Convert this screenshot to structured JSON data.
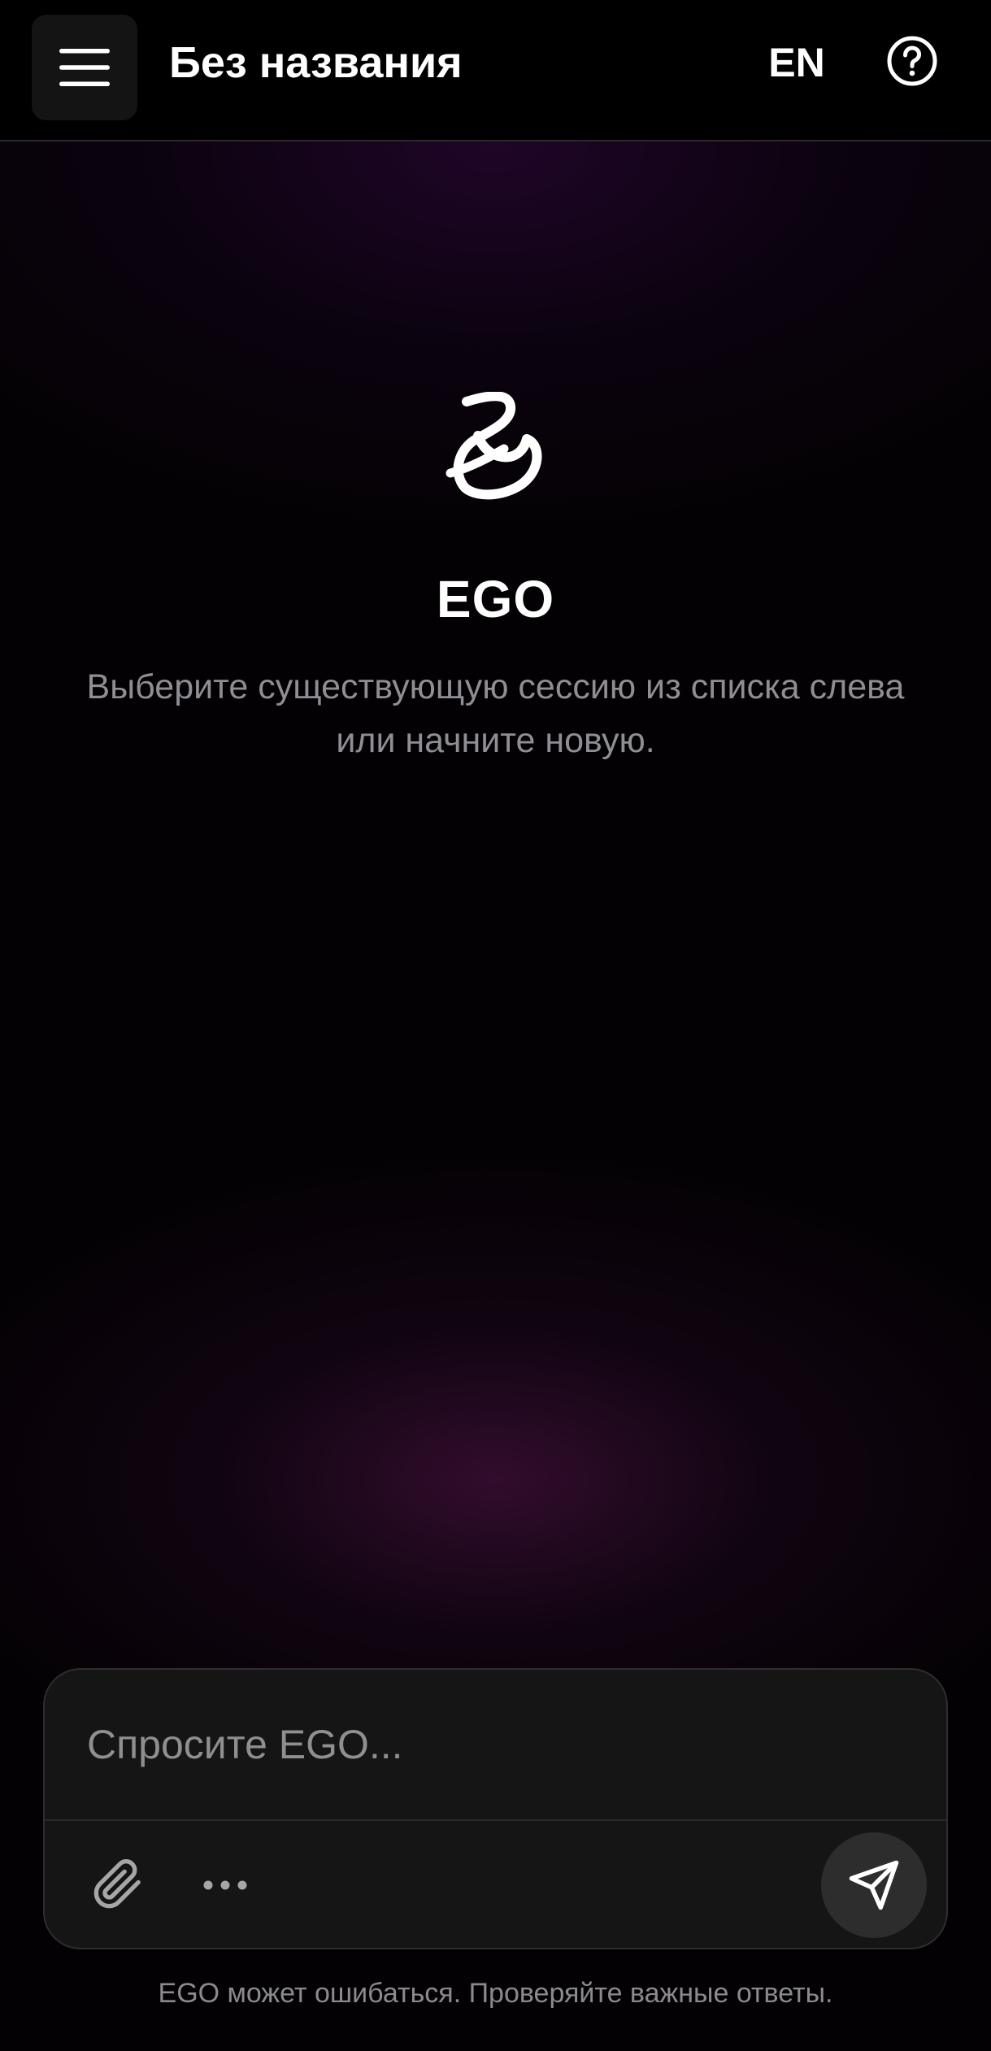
{
  "header": {
    "title": "Без названия",
    "language_label": "EN",
    "menu_icon": "hamburger-menu-icon",
    "help_icon": "question-circle-icon"
  },
  "welcome": {
    "logo_icon": "ego-logo-icon",
    "brand": "EGO",
    "subtitle": "Выберите существующую сессию из списка слева или начните новую."
  },
  "composer": {
    "placeholder": "Спросите EGO...",
    "value": "",
    "attach_icon": "paperclip-icon",
    "more_icon": "more-horizontal-icon",
    "send_icon": "send-icon"
  },
  "footer": {
    "disclaimer": "EGO может ошибаться. Проверяйте важные ответы."
  },
  "colors": {
    "background": "#030103",
    "header_bg": "#000000",
    "accent_glow": "#3a0e34",
    "muted_text": "#8e8e94",
    "composer_bg": "#151515",
    "send_button_bg": "#2d2d2d"
  }
}
